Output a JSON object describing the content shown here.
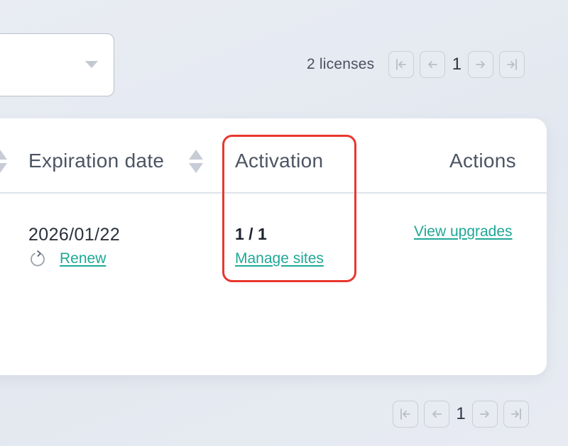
{
  "filter": {
    "caret_icon": "chevron-down-icon"
  },
  "pagination_top": {
    "count_label": "2 licenses",
    "page": "1"
  },
  "pagination_bottom": {
    "page": "1"
  },
  "table": {
    "headers": {
      "expiration": "Expiration date",
      "activation": "Activation",
      "actions": "Actions"
    },
    "row": {
      "expiration_date": "2026/01/22",
      "renew_label": "Renew",
      "activation_count": "1 / 1",
      "manage_label": "Manage sites",
      "upgrades_label": "View upgrades"
    }
  },
  "colors": {
    "link": "#1fa896",
    "highlight": "#e8372f",
    "background": "#e6eaf1"
  }
}
